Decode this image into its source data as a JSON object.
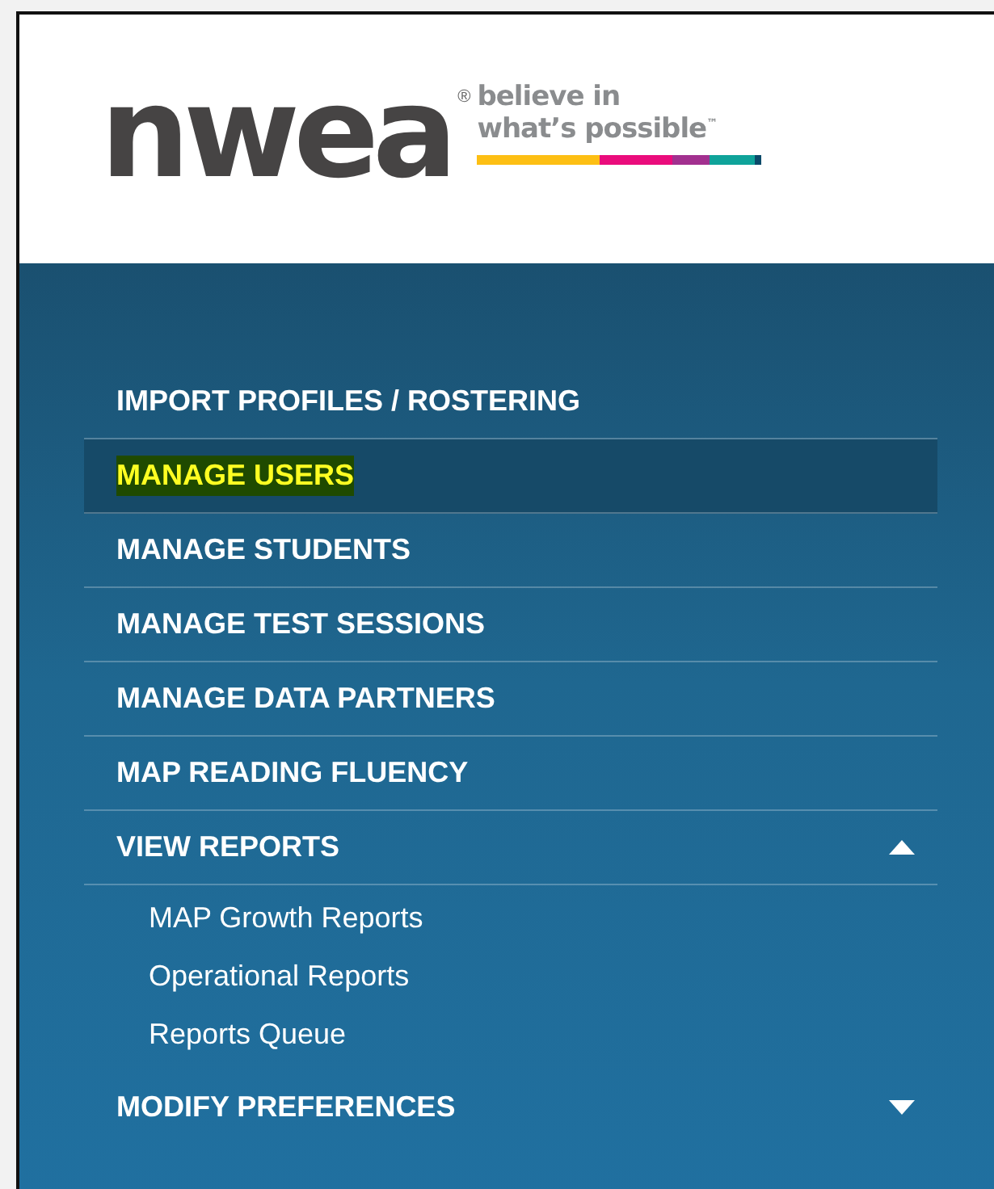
{
  "logo": {
    "wordmark": "nwea",
    "registered": "®",
    "tagline": [
      "believe in",
      "what’s possible"
    ],
    "trademark": "™"
  },
  "nav": {
    "items": [
      {
        "label": "IMPORT PROFILES / ROSTERING",
        "selected": false
      },
      {
        "label": "MANAGE USERS",
        "selected": true
      },
      {
        "label": "MANAGE STUDENTS",
        "selected": false
      },
      {
        "label": "MANAGE TEST SESSIONS",
        "selected": false
      },
      {
        "label": "MANAGE DATA PARTNERS",
        "selected": false
      },
      {
        "label": "MAP READING FLUENCY",
        "selected": false
      },
      {
        "label": "VIEW REPORTS",
        "selected": false,
        "expanded": true,
        "children": [
          {
            "label": "MAP Growth Reports"
          },
          {
            "label": "Operational Reports"
          },
          {
            "label": "Reports Queue"
          }
        ]
      },
      {
        "label": "MODIFY PREFERENCES",
        "selected": false,
        "expanded": false
      }
    ]
  }
}
